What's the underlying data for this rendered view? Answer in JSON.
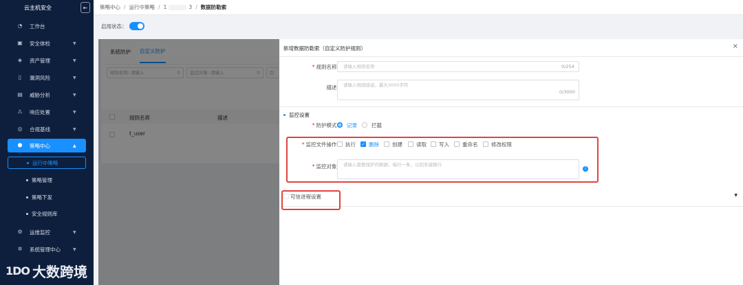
{
  "sidebar": {
    "title": "云主机安全",
    "items": [
      {
        "label": "工作台",
        "icon": "dashboard-icon",
        "arrow": false
      },
      {
        "label": "安全体检",
        "icon": "check-icon",
        "arrow": true
      },
      {
        "label": "资产管理",
        "icon": "layers-icon",
        "arrow": true
      },
      {
        "label": "漏洞风险",
        "icon": "bug-icon",
        "arrow": true
      },
      {
        "label": "威胁分析",
        "icon": "monitor-icon",
        "arrow": true
      },
      {
        "label": "响应处置",
        "icon": "alert-icon",
        "arrow": true
      },
      {
        "label": "合规基线",
        "icon": "compass-icon",
        "arrow": true
      },
      {
        "label": "策略中心",
        "icon": "shield-icon",
        "arrow": true
      },
      {
        "label": "运维监控",
        "icon": "gear-icon",
        "arrow": true
      },
      {
        "label": "系统管理中心",
        "icon": "settings-icon",
        "arrow": true
      }
    ],
    "subitems": [
      {
        "label": "运行中策略"
      },
      {
        "label": "策略管理"
      },
      {
        "label": "策略下发"
      },
      {
        "label": "安全规则库"
      }
    ]
  },
  "watermark": {
    "logo": "1DO",
    "text": "大数跨境"
  },
  "breadcrumb": {
    "b1": "策略中心",
    "b2": "运行中策略",
    "b3a": "1",
    "b3b": "3",
    "b4": "数据防勒索"
  },
  "enable": {
    "label": "启用状态："
  },
  "background": {
    "tabs": [
      "系统防护",
      "自定义防护"
    ],
    "filter1": "规则名称: 请输入",
    "filter2": "监控对象: 请输入",
    "filter3": "匹",
    "col_name": "规则名称",
    "col_desc": "描述",
    "row_name": "t_user"
  },
  "drawer": {
    "title": "新增数据防勒索（自定义防护规则）",
    "close": "×",
    "rule_name_label": "规则名称:",
    "rule_name_placeholder": "请输入规则名称",
    "rule_name_counter": "0/254",
    "desc_label": "描述:",
    "desc_placeholder": "请输入规则描述，最大3000字符",
    "desc_counter": "0/3000",
    "section_title": "监控设置",
    "mode_label": "防护模式:",
    "mode_options": [
      "记录",
      "拦截"
    ],
    "ops_label": "监控文件操作:",
    "ops": [
      {
        "label": "执行",
        "checked": false
      },
      {
        "label": "删除",
        "checked": true
      },
      {
        "label": "创建",
        "checked": false
      },
      {
        "label": "读取",
        "checked": false
      },
      {
        "label": "写入",
        "checked": false
      },
      {
        "label": "重命名",
        "checked": false
      },
      {
        "label": "修改权限",
        "checked": false
      }
    ],
    "target_label": "监控对象:",
    "target_placeholder": "请输入需要保护的数据，每行一条，以回车键换行",
    "info": "i",
    "trusted_label": "可信进程设置"
  }
}
